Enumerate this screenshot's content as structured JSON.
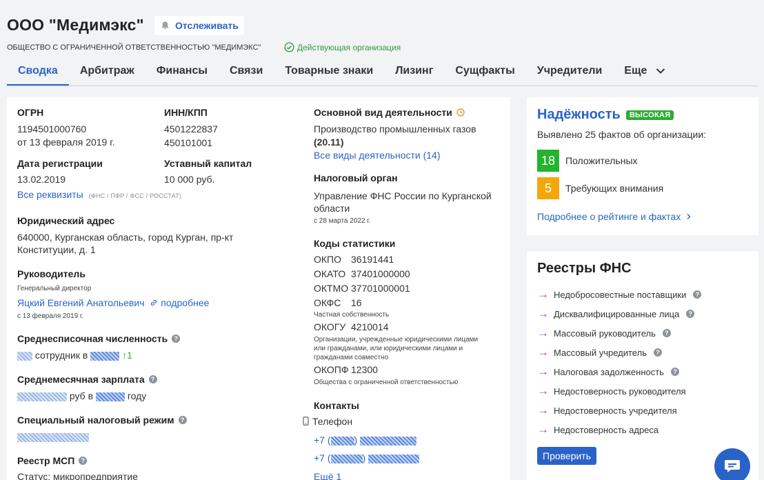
{
  "header": {
    "title": "ООО \"Медимэкс\"",
    "follow_label": "Отслеживать",
    "full_name": "ОБЩЕСТВО С ОГРАНИЧЕННОЙ ОТВЕТСТВЕННОСТЬЮ \"МЕДИМЭКС\"",
    "status": "Действующая организация"
  },
  "tabs": [
    {
      "label": "Сводка"
    },
    {
      "label": "Арбитраж"
    },
    {
      "label": "Финансы"
    },
    {
      "label": "Связи"
    },
    {
      "label": "Товарные знаки"
    },
    {
      "label": "Лизинг"
    },
    {
      "label": "Сущфакты"
    },
    {
      "label": "Учредители"
    },
    {
      "label": "Еще"
    }
  ],
  "summary": {
    "ogrn_label": "ОГРН",
    "ogrn": "1194501000760",
    "ogrn_date": "от 13 февраля 2019 г.",
    "inn_label": "ИНН/КПП",
    "inn": "4501222837",
    "kpp": "450101001",
    "reg_date_label": "Дата регистрации",
    "reg_date": "13.02.2019",
    "capital_label": "Уставный капитал",
    "capital": "10 000 руб.",
    "all_details_link": "Все реквизиты",
    "all_details_sources": "(ФНС / ПФР / ФСС / РОССТАТ)",
    "address_label": "Юридический адрес",
    "address_line1": "640000, Курганская область, город Курган, пр-кт",
    "address_line2": "Конституции, д. 1",
    "head_label": "Руководитель",
    "head_position": "Генеральный директор",
    "head_name": "Яцкий Евгений Анатольевич",
    "head_more": "подробнее",
    "head_since": "с 13 февраля 2019 г.",
    "employees_label": "Среднесписочная численность",
    "employees_text1": "сотрудник в",
    "employees_delta": "↑1",
    "salary_label": "Среднемесячная зарплата",
    "salary_text1": "руб в",
    "salary_text2": "году",
    "tax_mode_label": "Специальный налоговый режим",
    "msp_label": "Реестр МСП",
    "msp_status": "Статус: микропредприятие"
  },
  "activity": {
    "main_label": "Основной вид деятельности",
    "main_text": "Производство промышленных газов",
    "main_code": "(20.11)",
    "all_link": "Все виды деятельности (14)",
    "tax_label": "Налоговый орган",
    "tax_line1": "Управление ФНС России по Курганской",
    "tax_line2": "области",
    "tax_since": "с 28 марта 2022 г.",
    "stats_label": "Коды статистики",
    "okpo_label": "ОКПО",
    "okpo": "36191441",
    "okato_label": "ОКАТО",
    "okato": "37401000000",
    "oktmo_label": "ОКТМО",
    "oktmo": "37701000001",
    "okfs_label": "ОКФС",
    "okfs": "16",
    "okfs_desc": "Частная собственность",
    "okogu_label": "ОКОГУ",
    "okogu": "4210014",
    "okogu_desc1": "Организации, учрежденные юридическими лицами",
    "okogu_desc2": "или гражданами, или юридическими лицами и",
    "okogu_desc3": "гражданами совместно",
    "okopf_label": "ОКОПФ",
    "okopf": "12300",
    "okopf_desc": "Общества с ограниченной ответственностью",
    "contacts_label": "Контакты",
    "phone_label": "Телефон",
    "phone_prefix": "+7",
    "more_link": "Ещё 1"
  },
  "reliability": {
    "title": "Надёжность",
    "badge": "ВЫСОКАЯ",
    "subtitle": "Выявлено 25 фактов об организации:",
    "positive_count": "18",
    "positive_label": "Положительных",
    "attention_count": "5",
    "attention_label": "Требующих внимания",
    "more_link": "Подробнее о рейтинге и фактах",
    "colors": {
      "positive": "#22b42d",
      "attention": "#f2a80b",
      "badge": "#2eaa37"
    }
  },
  "fns": {
    "title": "Реестры ФНС",
    "items": [
      {
        "label": "Недобросовестные поставщики"
      },
      {
        "label": "Дисквалифицированные лица"
      },
      {
        "label": "Массовый руководитель"
      },
      {
        "label": "Массовый учредитель"
      },
      {
        "label": "Налоговая задолженность"
      },
      {
        "label": "Недостоверность руководителя"
      },
      {
        "label": "Недостоверность учредителя"
      },
      {
        "label": "Недостоверность адреса"
      }
    ],
    "check_label": "Проверить"
  },
  "theme": {
    "accent": "#2a63c8",
    "arrow": "#a63bd6"
  }
}
